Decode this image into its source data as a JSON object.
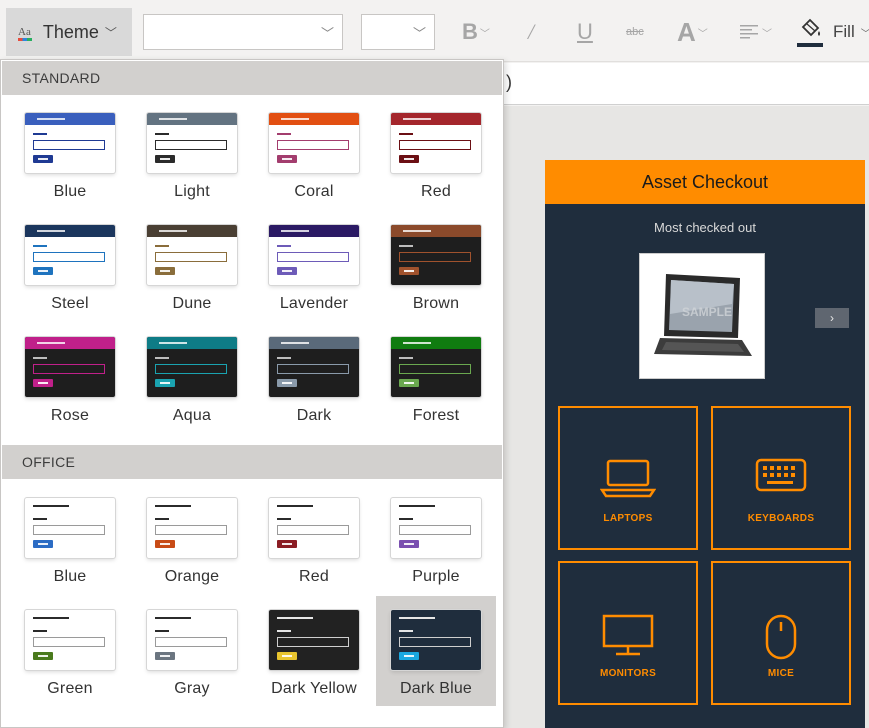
{
  "toolbar": {
    "theme_label": "Theme",
    "theme_icon_text": "Aa",
    "fill_label": "Fill",
    "bold_glyph": "B",
    "italic_glyph": "/",
    "underline_glyph": "U",
    "strike_glyph": "abc",
    "fontcolor_glyph": "A",
    "icons": [
      "theme-icon",
      "bold-icon",
      "italic-icon",
      "underline-icon",
      "strikethrough-icon",
      "font-color-icon",
      "align-icon",
      "fill-bucket-icon"
    ],
    "fill_color": "#1f2d3d"
  },
  "formula_bar": {
    "text": ")"
  },
  "dropdown": {
    "standard_title": "STANDARD",
    "office_title": "OFFICE",
    "standard": [
      {
        "name": "Blue",
        "header": "#3a5fbd",
        "accent": "#1f3a93",
        "dark": false
      },
      {
        "name": "Light",
        "header": "#637381",
        "accent": "#2b2b2b",
        "dark": false
      },
      {
        "name": "Coral",
        "header": "#e24f12",
        "accent": "#a33d6e",
        "dark": false
      },
      {
        "name": "Red",
        "header": "#a4262c",
        "accent": "#6b0f14",
        "dark": false
      },
      {
        "name": "Steel",
        "header": "#1b365d",
        "accent": "#1e73be",
        "dark": false
      },
      {
        "name": "Dune",
        "header": "#4a3f33",
        "accent": "#8a6d3b",
        "dark": false
      },
      {
        "name": "Lavender",
        "header": "#2b1a64",
        "accent": "#6d5bb8",
        "dark": false
      },
      {
        "name": "Brown",
        "header": "#8b4a2b",
        "accent": "#a0522d",
        "dark": true
      },
      {
        "name": "Rose",
        "header": "#c0208a",
        "accent": "#c0208a",
        "dark": true
      },
      {
        "name": "Aqua",
        "header": "#0e7c86",
        "accent": "#1aa3b0",
        "dark": true
      },
      {
        "name": "Dark",
        "header": "#5a6a7a",
        "accent": "#8a9aaa",
        "dark": true
      },
      {
        "name": "Forest",
        "header": "#107c10",
        "accent": "#6aa84f",
        "dark": true
      }
    ],
    "office": [
      {
        "name": "Blue",
        "accent": "#2b6cc4",
        "dark": false
      },
      {
        "name": "Orange",
        "accent": "#c84b16",
        "dark": false
      },
      {
        "name": "Red",
        "accent": "#8b1d24",
        "dark": false
      },
      {
        "name": "Purple",
        "accent": "#7a4fb0",
        "dark": false
      },
      {
        "name": "Green",
        "accent": "#4a7a1d",
        "dark": false
      },
      {
        "name": "Gray",
        "accent": "#6b7580",
        "dark": false
      },
      {
        "name": "Dark Yellow",
        "accent": "#e8c42e",
        "dark": true
      },
      {
        "name": "Dark Blue",
        "accent": "#1aa8e0",
        "dark": true,
        "selected": true
      }
    ]
  },
  "app": {
    "title": "Asset Checkout",
    "subtitle": "Most checked out",
    "next_glyph": "›",
    "watermark": "SAMPLE",
    "categories": [
      {
        "label": "LAPTOPS",
        "icon": "laptop-icon"
      },
      {
        "label": "KEYBOARDS",
        "icon": "keyboard-icon"
      },
      {
        "label": "MONITORS",
        "icon": "monitor-icon"
      },
      {
        "label": "MICE",
        "icon": "mouse-icon"
      }
    ],
    "accent": "#ff8c00",
    "background": "#1f2d3d"
  }
}
